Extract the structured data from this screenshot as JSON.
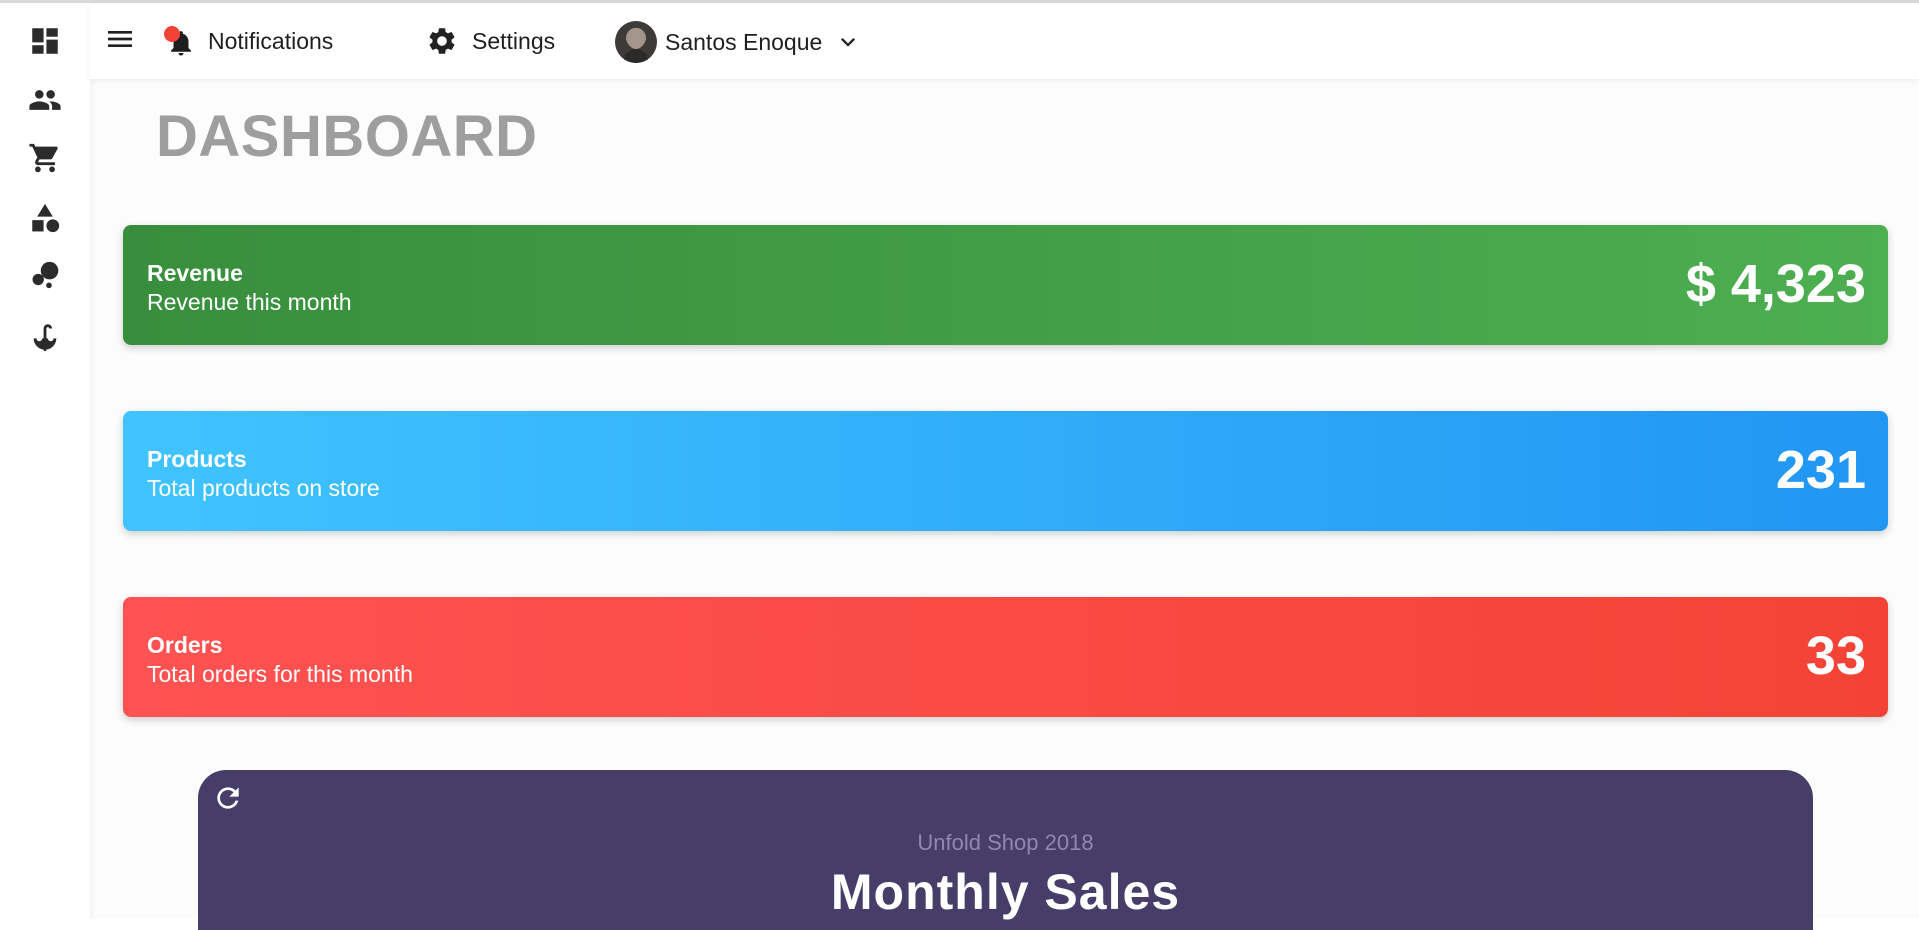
{
  "sidebar": {
    "items": [
      {
        "icon": "dashboard-icon"
      },
      {
        "icon": "users-icon"
      },
      {
        "icon": "cart-icon"
      },
      {
        "icon": "shapes-icon"
      },
      {
        "icon": "bubbles-icon"
      },
      {
        "icon": "umbrella-icon"
      }
    ]
  },
  "topbar": {
    "menu_icon": "menu-icon",
    "notifications_label": "Notifications",
    "settings_label": "Settings",
    "user_name": "Santos Enoque"
  },
  "page": {
    "title": "DASHBOARD"
  },
  "stats": [
    {
      "title": "Revenue",
      "subtitle": "Revenue this month",
      "value": "$ 4,323",
      "color_from": "#388e3c",
      "color_to": "#4caf50"
    },
    {
      "title": "Products",
      "subtitle": "Total products on store",
      "value": "231",
      "color_from": "#40c4ff",
      "color_to": "#2196f3"
    },
    {
      "title": "Orders",
      "subtitle": "Total orders for this month",
      "value": "33",
      "color_from": "#ff5252",
      "color_to": "#f44336"
    }
  ],
  "sales_card": {
    "subtitle": "Unfold Shop 2018",
    "title": "Monthly Sales",
    "background": "#463e69"
  }
}
